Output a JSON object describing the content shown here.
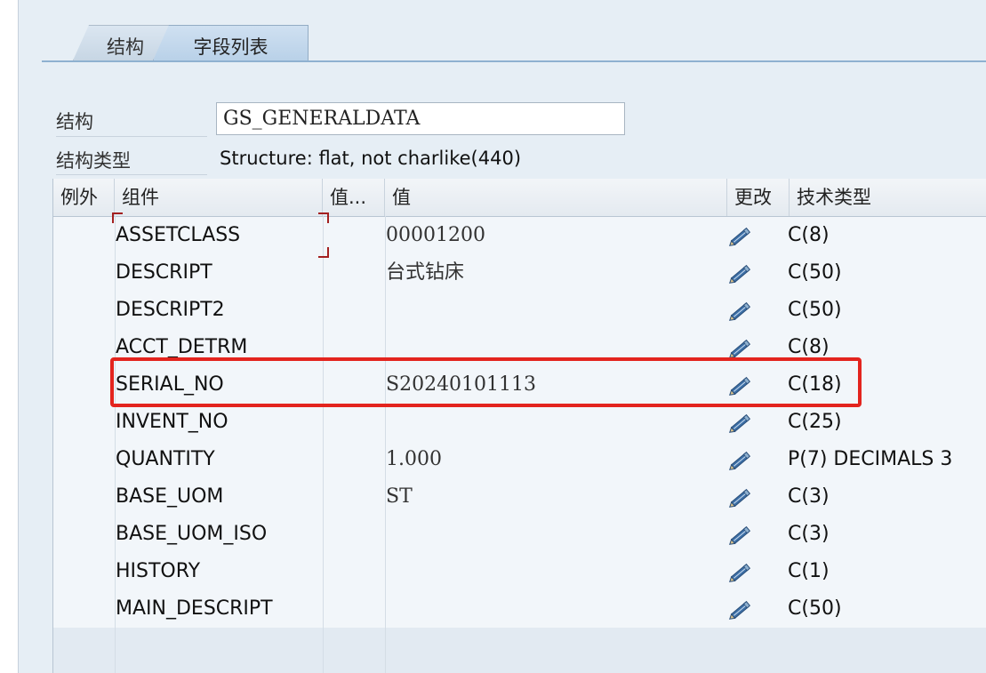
{
  "tabs": [
    {
      "label": "结构",
      "active": false
    },
    {
      "label": "字段列表",
      "active": true
    }
  ],
  "structure_field": {
    "label": "结构",
    "value": "GS_GENERALDATA"
  },
  "structure_type": {
    "label": "结构类型",
    "value": "Structure: flat, not charlike(440)"
  },
  "grid": {
    "headers": {
      "exception": "例外",
      "component": "组件",
      "value_short": "值...",
      "value": "值",
      "change": "更改",
      "tech_type": "技术类型"
    },
    "rows": [
      {
        "component": "ASSETCLASS",
        "value": "00001200",
        "tech_type": "C(8)"
      },
      {
        "component": "DESCRIPT",
        "value": "台式钻床",
        "tech_type": "C(50)"
      },
      {
        "component": "DESCRIPT2",
        "value": "",
        "tech_type": "C(50)"
      },
      {
        "component": "ACCT_DETRM",
        "value": "",
        "tech_type": "C(8)"
      },
      {
        "component": "SERIAL_NO",
        "value": "S20240101113",
        "tech_type": "C(18)"
      },
      {
        "component": "INVENT_NO",
        "value": "",
        "tech_type": "C(25)"
      },
      {
        "component": "QUANTITY",
        "value": "1.000",
        "tech_type": "P(7) DECIMALS 3"
      },
      {
        "component": "BASE_UOM",
        "value": "ST",
        "tech_type": "C(3)"
      },
      {
        "component": "BASE_UOM_ISO",
        "value": "",
        "tech_type": "C(3)"
      },
      {
        "component": "HISTORY",
        "value": "",
        "tech_type": "C(1)"
      },
      {
        "component": "MAIN_DESCRIPT",
        "value": "",
        "tech_type": "C(50)"
      }
    ]
  },
  "icons": {
    "edit": "pencil-icon"
  },
  "colors": {
    "highlight": "#e3241e",
    "selection": "#a32020",
    "pencil": "#3d6fa6"
  }
}
